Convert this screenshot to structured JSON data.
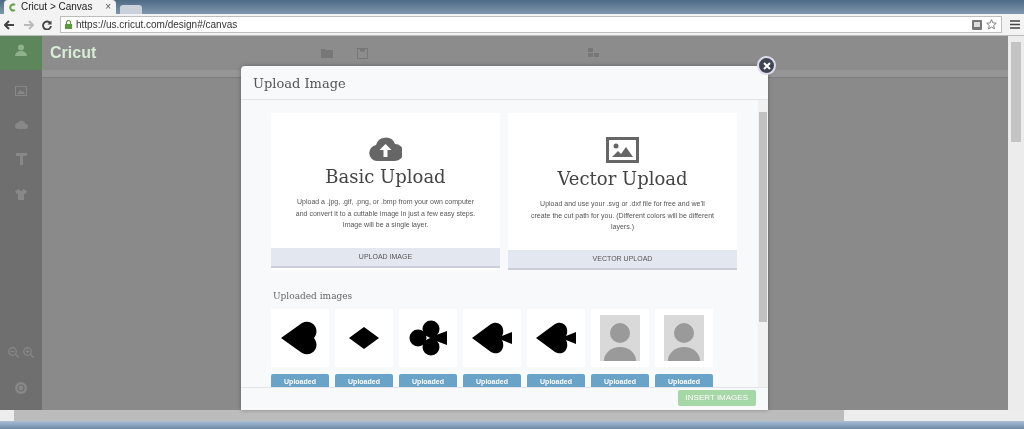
{
  "browser": {
    "tab": {
      "title": "Cricut > Canvas",
      "close": "×"
    },
    "url": "https://us.cricut.com/design#/canvas"
  },
  "app": {
    "logo": "Cricut"
  },
  "modal": {
    "title": "Upload Image",
    "options": [
      {
        "kind": "basic",
        "title": "Basic Upload",
        "description": "Upload a .jpg, .gif, .png, or .bmp from your own computer and convert it to a cuttable image in just a few easy steps. Image will be a single layer.",
        "button": "UPLOAD IMAGE"
      },
      {
        "kind": "vector",
        "title": "Vector Upload",
        "description": "Upload and use your .svg or .dxf file for free and we'll create the cut path for you. (Different colors will be different layers.)",
        "button": "VECTOR UPLOAD"
      }
    ],
    "uploaded_label": "Uploaded images",
    "images": [
      {
        "kind": "heart",
        "status": "Uploaded"
      },
      {
        "kind": "diamond",
        "status": "Uploaded"
      },
      {
        "kind": "club",
        "status": "Uploaded"
      },
      {
        "kind": "spade",
        "status": "Uploaded"
      },
      {
        "kind": "spade",
        "status": "Uploaded"
      },
      {
        "kind": "photo",
        "status": "Uploaded"
      },
      {
        "kind": "photo",
        "status": "Uploaded"
      }
    ],
    "insert_button": {
      "label": "INSERT IMAGES",
      "disabled": true
    }
  }
}
